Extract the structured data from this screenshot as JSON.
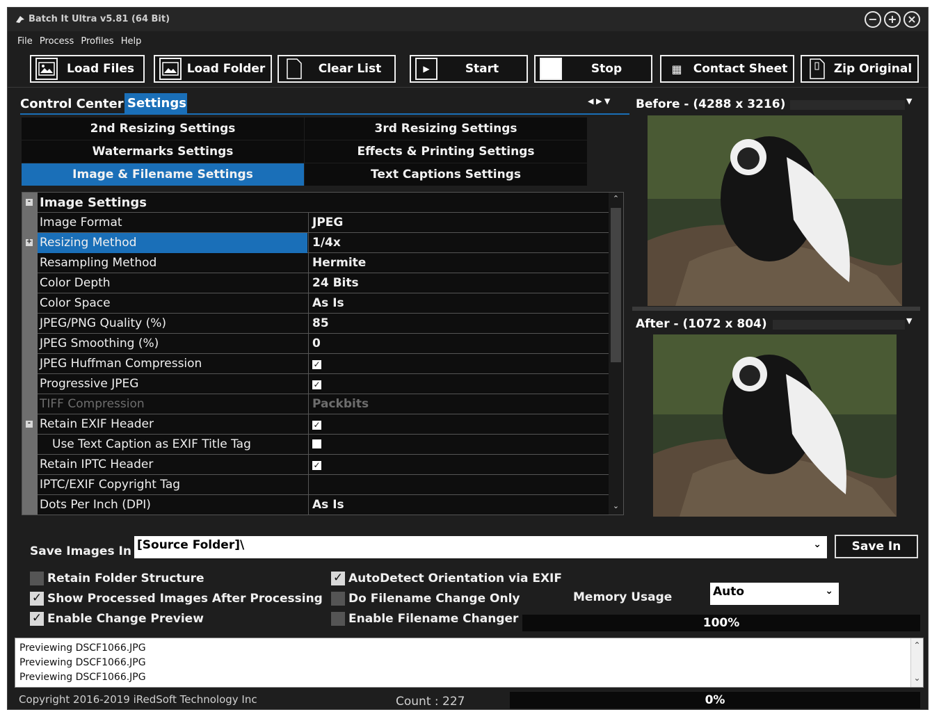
{
  "app": {
    "title": "Batch It Ultra v5.81 (64 Bit)",
    "window_controls": [
      "−",
      "+",
      "×"
    ]
  },
  "menu": [
    "File",
    "Process",
    "Profiles",
    "Help"
  ],
  "toolbar": {
    "load_files": "Load Files",
    "load_folder": "Load Folder",
    "clear_list": "Clear List",
    "start": "Start",
    "stop": "Stop",
    "contact_sheet": "Contact Sheet",
    "zip_original": "Zip Original"
  },
  "tabs": {
    "control_center": "Control Center",
    "settings": "Settings"
  },
  "settings_tabs": [
    "2nd Resizing Settings",
    "3rd Resizing Settings",
    "Watermarks Settings",
    "Effects & Printing Settings",
    "Image & Filename Settings",
    "Text Captions Settings"
  ],
  "grid": {
    "category": "Image Settings",
    "rows": [
      {
        "name": "Image Format",
        "value": "JPEG"
      },
      {
        "name": "Resizing Method",
        "value": "1/4x"
      },
      {
        "name": "Resampling Method",
        "value": "Hermite"
      },
      {
        "name": "Color Depth",
        "value": "24 Bits"
      },
      {
        "name": "Color Space",
        "value": "As Is"
      },
      {
        "name": "JPEG/PNG Quality (%)",
        "value": "85"
      },
      {
        "name": "JPEG Smoothing (%)",
        "value": "0"
      },
      {
        "name": "JPEG Huffman Compression",
        "value": "✓"
      },
      {
        "name": "Progressive JPEG",
        "value": "✓"
      },
      {
        "name": "TIFF Compression",
        "value": "Packbits"
      },
      {
        "name": "Retain EXIF Header",
        "value": "✓"
      },
      {
        "name": "Use Text Caption as EXIF Title Tag",
        "value": ""
      },
      {
        "name": "Retain IPTC Header",
        "value": "✓"
      },
      {
        "name": "IPTC/EXIF Copyright Tag",
        "value": ""
      },
      {
        "name": "Dots Per Inch (DPI)",
        "value": "As Is"
      }
    ]
  },
  "preview": {
    "before": "Before - (4288 x 3216)",
    "after": "After - (1072 x 804)"
  },
  "save": {
    "label": "Save Images In",
    "path": "[Source Folder]\\",
    "button": "Save In"
  },
  "options": {
    "retain_folder": "Retain Folder Structure",
    "show_processed": "Show Processed Images After Processing",
    "enable_preview": "Enable Change Preview",
    "autodetect": "AutoDetect Orientation via EXIF",
    "filename_only": "Do Filename Change Only",
    "filename_changer": "Enable Filename Changer"
  },
  "memory": {
    "label": "Memory Usage",
    "value": "Auto",
    "progress": "100%"
  },
  "log": [
    "Previewing DSCF1066.JPG",
    "Previewing DSCF1066.JPG",
    "Previewing DSCF1066.JPG"
  ],
  "status": {
    "copyright": "Copyright 2016-2019 iRedSoft Technology Inc",
    "count": "Count : 227",
    "progress": "0%"
  }
}
